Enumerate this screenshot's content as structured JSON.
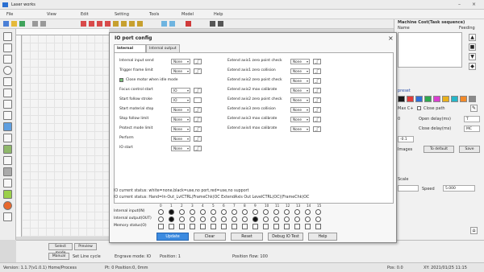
{
  "app": {
    "title": "Laser works",
    "win_min": "–",
    "win_close": "×"
  },
  "menu": [
    "File",
    "View",
    "Edit",
    "Setting",
    "Tools",
    "Model",
    "Help"
  ],
  "right_panel": {
    "header": "Machine Cost(Task sequence)",
    "col_name": "Name",
    "col_feed": "Feeding",
    "layer_label": "preset",
    "swatch_colors": [
      "#1a1a1a",
      "#e23b3b",
      "#2d6fd8",
      "#2fa84f",
      "#d93fd1",
      "#e8b11c",
      "#26b6c8",
      "#f28a2a",
      "#8a8a8a"
    ],
    "row1_label": "Max C+",
    "row1_check": "Close path",
    "row2_label": "0",
    "row2_text": "Open delay(ms)",
    "row2_value": "T",
    "row3_text": "Close delay(ms)",
    "row3_value": "MC",
    "row4_value": "-0.1",
    "btn_images": "Images",
    "btn_default": "To default",
    "btn_save": "Save",
    "scale_label": "Scale",
    "speed_label": "Speed",
    "speed_value": "5.000"
  },
  "dialog": {
    "title": "IO port config",
    "close": "×",
    "tabs": [
      "Internal input",
      "Internal output"
    ],
    "left_rows": [
      {
        "label": "Internal input send",
        "value": "None",
        "sig": "_|‾"
      },
      {
        "label": "Trigger frame limit",
        "value": "None",
        "sig": "_|‾"
      },
      {
        "label": "Close motor when idle mode",
        "value": "",
        "sig": ""
      },
      {
        "label": "Focus control start",
        "value": "IO",
        "sig": "_|‾"
      },
      {
        "label": "Start follow stroke",
        "value": "IO",
        "sig": ""
      },
      {
        "label": "Start material stop",
        "value": "None",
        "sig": "_|‾"
      },
      {
        "label": "Stop follow limit",
        "value": "None",
        "sig": "_|‾"
      },
      {
        "label": "Protect mode limit",
        "value": "None",
        "sig": "_|‾"
      },
      {
        "label": "Perform",
        "value": "None",
        "sig": "_|‾"
      },
      {
        "label": "IO start",
        "value": "None",
        "sig": "_|‾"
      }
    ],
    "right_rows": [
      {
        "label": "Extend axis1 zero point check",
        "value": "None",
        "sig": "_|‾"
      },
      {
        "label": "Extend axis1 zero collision",
        "value": "None",
        "sig": "_|‾"
      },
      {
        "label": "Extend axis2 zero point check",
        "value": "None",
        "sig": "_|‾"
      },
      {
        "label": "Extend axis2 max calibrate",
        "value": "None",
        "sig": "_|‾"
      },
      {
        "label": "Extend axis2 zero point check",
        "value": "None",
        "sig": "_|‾"
      },
      {
        "label": "Extend axis3 zero collision",
        "value": "None",
        "sig": "_|‾"
      },
      {
        "label": "Extend axis3 max calibrate",
        "value": "None",
        "sig": "_|‾"
      },
      {
        "label": "Extend axis4 max calibrate",
        "value": "None",
        "sig": "_|‾"
      }
    ],
    "desc1": "IO current status: white=none,black=use,no port,red=use,no support",
    "desc2": "IO current status: Hand=In-Out_LvlCTRL(FrameChk)OC  ExtendAxis Out LevelCTRL(OC)(FrameChk)OC",
    "io_numbers": [
      "0",
      "1",
      "2",
      "3",
      "4",
      "5",
      "6",
      "7",
      "8",
      "9",
      "10",
      "11",
      "12",
      "13",
      "14",
      "15"
    ],
    "io_rows": [
      {
        "label": "Internal input(IN)",
        "states": [
          0,
          1,
          0,
          0,
          0,
          0,
          0,
          0,
          0,
          0,
          0,
          0,
          0,
          0,
          0,
          0
        ]
      },
      {
        "label": "Internal output(OUT)",
        "states": [
          0,
          1,
          0,
          0,
          0,
          0,
          0,
          0,
          0,
          1,
          0,
          0,
          0,
          0,
          0,
          0
        ]
      },
      {
        "label": "Memory status(O)",
        "states": [
          0,
          0,
          0,
          0,
          0,
          0,
          0,
          0,
          0,
          0,
          0,
          0,
          0,
          0,
          0,
          0
        ]
      }
    ],
    "buttons": [
      "Update",
      "Clear",
      "Reset",
      "Debug IO Test",
      "Help"
    ]
  },
  "bottom": {
    "row1": [
      "Select mode",
      "Preview"
    ],
    "row2": [
      "Manual",
      "Set Line cycle",
      "Engrave mode: IO",
      "Position: 1",
      "Position flow: 100"
    ]
  },
  "status": {
    "left": "Version: 1.1.7(v1.0.1)  Home/Process",
    "mid": "Pt: 0   Position:0, 0mm",
    "right_a": "Pos: 0.0",
    "right_b": "XY: 2021/01/25 11:15"
  }
}
